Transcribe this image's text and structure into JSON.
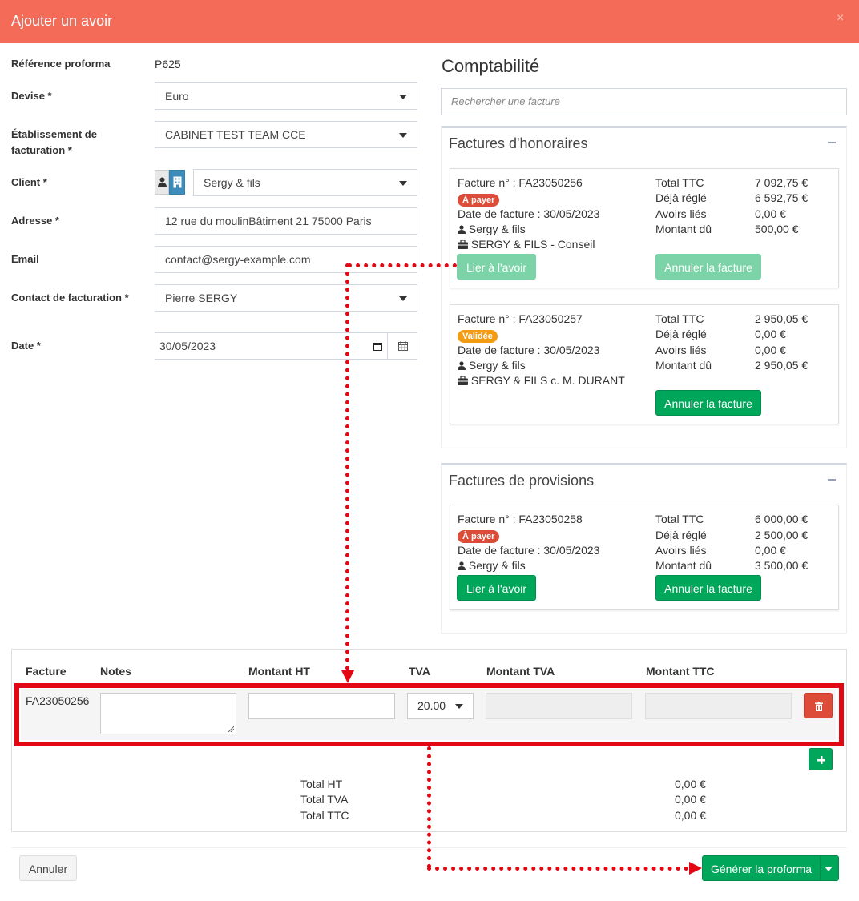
{
  "modal": {
    "title": "Ajouter un avoir",
    "close": "×"
  },
  "form": {
    "ref_label": "Référence proforma",
    "ref_value": "P625",
    "devise_label": "Devise *",
    "devise_value": "Euro",
    "etab_label": "Établissement de facturation *",
    "etab_value": "CABINET TEST TEAM CCE",
    "client_label": "Client *",
    "client_value": "Sergy & fils",
    "adresse_label": "Adresse *",
    "adresse_value": "12 rue du moulinBâtiment 21 75000 Paris",
    "email_label": "Email",
    "email_value": "contact@sergy-example.com",
    "contact_label": "Contact de facturation *",
    "contact_value": "Pierre SERGY",
    "date_label": "Date *",
    "date_value": "30/05/2023"
  },
  "compta": {
    "title": "Comptabilité",
    "search_placeholder": "Rechercher une facture",
    "honoraires": {
      "title": "Factures d'honoraires",
      "cards": [
        {
          "number": "Facture n° : FA23050256",
          "badge": "À payer",
          "badge_color": "#dd4b39",
          "date": "Date de facture : 30/05/2023",
          "client": "Sergy & fils",
          "mission": "SERGY & FILS - Conseil",
          "ttc_label": "Total TTC",
          "ttc": "7 092,75 €",
          "regle_label": "Déjà réglé",
          "regle": "6 592,75 €",
          "avoirs_label": "Avoirs liés",
          "avoirs": "0,00 €",
          "du_label": "Montant dû",
          "du": "500,00 €",
          "link_label": "Lier à l'avoir",
          "cancel_label": "Annuler la facture"
        },
        {
          "number": "Facture n° : FA23050257",
          "badge": "Validée",
          "badge_color": "#f39c12",
          "date": "Date de facture : 30/05/2023",
          "client": "Sergy & fils",
          "mission": "SERGY & FILS c. M. DURANT",
          "ttc_label": "Total TTC",
          "ttc": "2 950,05 €",
          "regle_label": "Déjà réglé",
          "regle": "0,00 €",
          "avoirs_label": "Avoirs liés",
          "avoirs": "0,00 €",
          "du_label": "Montant dû",
          "du": "2 950,05 €",
          "cancel_label": "Annuler la facture"
        }
      ]
    },
    "provisions": {
      "title": "Factures de provisions",
      "cards": [
        {
          "number": "Facture n° : FA23050258",
          "badge": "À payer",
          "badge_color": "#dd4b39",
          "date": "Date de facture : 30/05/2023",
          "client": "Sergy & fils",
          "ttc_label": "Total TTC",
          "ttc": "6 000,00 €",
          "regle_label": "Déjà réglé",
          "regle": "2 500,00 €",
          "avoirs_label": "Avoirs liés",
          "avoirs": "0,00 €",
          "du_label": "Montant dû",
          "du": "3 500,00 €",
          "link_label": "Lier à l'avoir",
          "cancel_label": "Annuler la facture"
        }
      ]
    }
  },
  "table": {
    "headers": [
      "Facture",
      "Notes",
      "Montant HT",
      "TVA",
      "Montant TVA",
      "Montant TTC"
    ],
    "row": {
      "facture": "FA23050256",
      "tva": "20.00"
    },
    "totals": [
      {
        "label": "Total HT",
        "value": "0,00 €"
      },
      {
        "label": "Total TVA",
        "value": "0,00 €"
      },
      {
        "label": "Total TTC",
        "value": "0,00 €"
      }
    ]
  },
  "footer": {
    "cancel_label": "Annuler",
    "generate_label": "Générer la proforma"
  },
  "colors": {
    "header": "#f46b57",
    "success": "#00a65a",
    "danger": "#dd4b39",
    "warning": "#f39c12",
    "annotation": "#e30613"
  }
}
